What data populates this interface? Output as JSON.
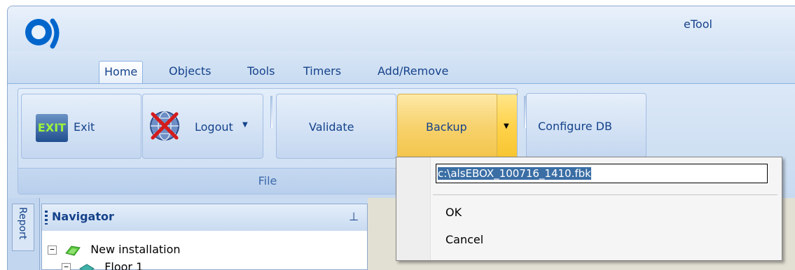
{
  "window": {
    "title": "eTool"
  },
  "tabs": [
    {
      "label": "Home",
      "active": true
    },
    {
      "label": "Objects"
    },
    {
      "label": "Tools"
    },
    {
      "label": "Timers"
    },
    {
      "label": "Add/Remove"
    }
  ],
  "ribbon": {
    "group_label": "File",
    "buttons": {
      "exit_icon_text": "EXIT",
      "exit": "Exit",
      "logout": "Logout",
      "validate": "Validate",
      "backup": "Backup",
      "configure_db": "Configure DB"
    }
  },
  "side_tabs": {
    "report": "Report"
  },
  "navigator": {
    "title": "Navigator",
    "tree": [
      {
        "label": "New installation",
        "expander": "−",
        "level": 0
      },
      {
        "label": "Floor 1",
        "expander": "−",
        "level": 1
      }
    ]
  },
  "backup_menu": {
    "path_value": "c:\\alsEBOX_100716_1410.fbk",
    "ok": "OK",
    "cancel": "Cancel"
  },
  "colors": {
    "ribbon_bg": "#c9dcf2",
    "accent": "#15428b",
    "backup_highlight": "#f7d26d",
    "selection": "#3a6ea5"
  }
}
